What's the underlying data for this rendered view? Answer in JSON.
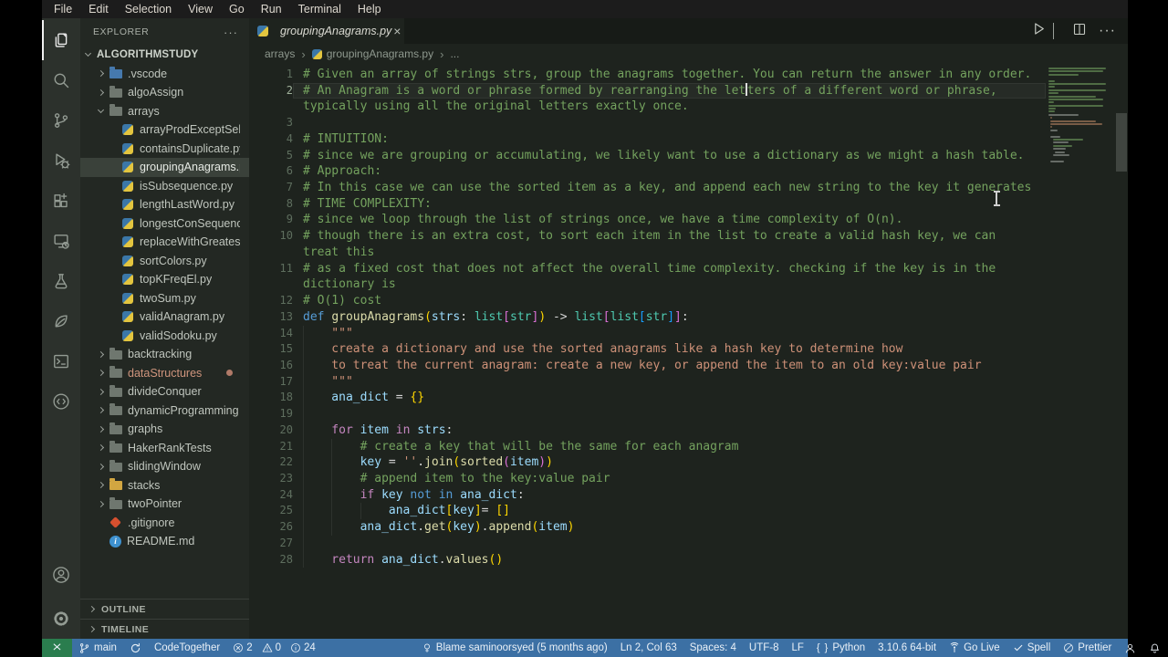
{
  "menu_bar": {
    "items": [
      "File",
      "Edit",
      "Selection",
      "View",
      "Go",
      "Run",
      "Terminal",
      "Help"
    ]
  },
  "activity_bar": {
    "top": [
      {
        "name": "explorer",
        "icon": "files-icon",
        "active": true
      },
      {
        "name": "search",
        "icon": "search-icon",
        "active": false
      },
      {
        "name": "source-control",
        "icon": "source-control-icon",
        "active": false
      },
      {
        "name": "run-debug",
        "icon": "debug-icon",
        "active": false
      },
      {
        "name": "extensions",
        "icon": "extensions-icon",
        "active": false
      },
      {
        "name": "remote-explorer",
        "icon": "remote-explorer-icon",
        "active": false
      },
      {
        "name": "testing",
        "icon": "beaker-icon",
        "active": false
      },
      {
        "name": "mongodb",
        "icon": "leaf-icon",
        "active": false
      },
      {
        "name": "terminal-tool",
        "icon": "terminal-box-icon",
        "active": false
      },
      {
        "name": "live-code",
        "icon": "code-circle-icon",
        "active": false
      }
    ],
    "bottom": [
      {
        "name": "accounts",
        "icon": "account-icon",
        "active": false
      },
      {
        "name": "settings",
        "icon": "gear-icon",
        "active": false
      }
    ]
  },
  "sidebar": {
    "title": "EXPLORER",
    "more_glyph": "···",
    "root": "ALGORITHMSTUDY",
    "tree": [
      {
        "label": ".vscode",
        "level": 1,
        "chevron": "right",
        "icon": "vscode-folder-icon"
      },
      {
        "label": "algoAssign",
        "level": 1,
        "chevron": "right",
        "icon": "folder-icon"
      },
      {
        "label": "arrays",
        "level": 1,
        "chevron": "down",
        "icon": "folder-icon"
      },
      {
        "label": "arrayProdExceptSel...",
        "level": 2,
        "icon": "python-icon"
      },
      {
        "label": "containsDuplicate.py",
        "level": 2,
        "icon": "python-icon"
      },
      {
        "label": "groupingAnagrams.py",
        "level": 2,
        "icon": "python-icon",
        "selected": true
      },
      {
        "label": "isSubsequence.py",
        "level": 2,
        "icon": "python-icon"
      },
      {
        "label": "lengthLastWord.py",
        "level": 2,
        "icon": "python-icon"
      },
      {
        "label": "longestConSequenc...",
        "level": 2,
        "icon": "python-icon"
      },
      {
        "label": "replaceWithGreates...",
        "level": 2,
        "icon": "python-icon"
      },
      {
        "label": "sortColors.py",
        "level": 2,
        "icon": "python-icon"
      },
      {
        "label": "topKFreqEl.py",
        "level": 2,
        "icon": "python-icon"
      },
      {
        "label": "twoSum.py",
        "level": 2,
        "icon": "python-icon"
      },
      {
        "label": "validAnagram.py",
        "level": 2,
        "icon": "python-icon"
      },
      {
        "label": "validSodoku.py",
        "level": 2,
        "icon": "python-icon"
      },
      {
        "label": "backtracking",
        "level": 1,
        "chevron": "right",
        "icon": "folder-icon"
      },
      {
        "label": "dataStructures",
        "level": 1,
        "chevron": "right",
        "icon": "folder-icon",
        "modified": true
      },
      {
        "label": "divideConquer",
        "level": 1,
        "chevron": "right",
        "icon": "folder-icon"
      },
      {
        "label": "dynamicProgramming",
        "level": 1,
        "chevron": "right",
        "icon": "folder-icon"
      },
      {
        "label": "graphs",
        "level": 1,
        "chevron": "right",
        "icon": "folder-icon"
      },
      {
        "label": "HakerRankTests",
        "level": 1,
        "chevron": "right",
        "icon": "folder-icon"
      },
      {
        "label": "slidingWindow",
        "level": 1,
        "chevron": "right",
        "icon": "folder-icon"
      },
      {
        "label": "stacks",
        "level": 1,
        "chevron": "right",
        "icon": "folder-yellow-icon"
      },
      {
        "label": "twoPointer",
        "level": 1,
        "chevron": "right",
        "icon": "folder-icon"
      },
      {
        "label": ".gitignore",
        "level": 1,
        "icon": "gitignore-icon"
      },
      {
        "label": "README.md",
        "level": 1,
        "icon": "info-icon"
      }
    ],
    "panels": [
      {
        "label": "OUTLINE"
      },
      {
        "label": "TIMELINE"
      }
    ]
  },
  "editor": {
    "tab": {
      "label": "groupingAnagrams.py",
      "icon": "python-icon",
      "close_glyph": "×"
    },
    "actions": [
      {
        "name": "run",
        "icon": "play-icon"
      },
      {
        "name": "run-dropdown",
        "icon": "chevron-down-icon"
      },
      {
        "name": "split-editor",
        "icon": "split-icon"
      },
      {
        "name": "more-actions",
        "icon": "ellipsis-icon"
      }
    ],
    "breadcrumb_separator": "›",
    "breadcrumbs": [
      {
        "label": "arrays"
      },
      {
        "label": "groupingAnagrams.py",
        "icon": "python-icon"
      },
      {
        "label": "..."
      }
    ],
    "code": [
      {
        "n": "1",
        "rows": [
          [
            [
              "cm",
              "# Given an array of strings strs, group the anagrams together. You can return the answer in any order."
            ]
          ]
        ]
      },
      {
        "n": "2",
        "current": true,
        "rows": [
          [
            [
              "cm",
              "# An Anagram is a word or phrase formed by rearranging the let"
            ],
            [
              "caret",
              ""
            ],
            [
              "cm",
              "ters of a different word or phrase,"
            ]
          ],
          [
            [
              "cm",
              "typically using all the original letters exactly once."
            ]
          ]
        ]
      },
      {
        "n": "3",
        "rows": [
          []
        ]
      },
      {
        "n": "4",
        "rows": [
          [
            [
              "cm",
              "# INTUITION:"
            ]
          ]
        ]
      },
      {
        "n": "5",
        "rows": [
          [
            [
              "cm",
              "# since we are grouping or accumulating, we likely want to use a dictionary as we might a hash table."
            ]
          ]
        ]
      },
      {
        "n": "6",
        "rows": [
          [
            [
              "cm",
              "# Approach:"
            ]
          ]
        ]
      },
      {
        "n": "7",
        "rows": [
          [
            [
              "cm",
              "# In this case we can use the sorted item as a key, and append each new string to the key it generates"
            ]
          ]
        ]
      },
      {
        "n": "8",
        "rows": [
          [
            [
              "cm",
              "# TIME COMPLEXITY:"
            ]
          ]
        ]
      },
      {
        "n": "9",
        "rows": [
          [
            [
              "cm",
              "# since we loop through the list of strings once, we have a time complexity of O(n)."
            ]
          ]
        ]
      },
      {
        "n": "10",
        "rows": [
          [
            [
              "cm",
              "# though there is an extra cost, to sort each item in the list to create a valid hash key, we can"
            ]
          ],
          [
            [
              "cm",
              "treat this"
            ]
          ]
        ]
      },
      {
        "n": "11",
        "rows": [
          [
            [
              "cm",
              "# as a fixed cost that does not affect the overall time complexity. checking if the key is in the"
            ]
          ],
          [
            [
              "cm",
              "dictionary is"
            ]
          ]
        ]
      },
      {
        "n": "12",
        "rows": [
          [
            [
              "cm",
              "# O(1) cost"
            ]
          ]
        ]
      },
      {
        "n": "13",
        "rows": [
          [
            [
              "kw",
              "def "
            ],
            [
              "fn",
              "groupAnagrams"
            ],
            [
              "b1",
              "("
            ],
            [
              "vr",
              "strs"
            ],
            [
              "pu",
              ": "
            ],
            [
              "ty",
              "list"
            ],
            [
              "b2",
              "["
            ],
            [
              "ty",
              "str"
            ],
            [
              "b2",
              "]"
            ],
            [
              "b1",
              ")"
            ],
            [
              "pu",
              " -> "
            ],
            [
              "ty",
              "list"
            ],
            [
              "b2",
              "["
            ],
            [
              "ty",
              "list"
            ],
            [
              "b3",
              "["
            ],
            [
              "ty",
              "str"
            ],
            [
              "b3",
              "]"
            ],
            [
              "b2",
              "]"
            ],
            [
              "pu",
              ":"
            ]
          ]
        ]
      },
      {
        "n": "14",
        "rows": [
          [
            [
              "ind",
              "    "
            ],
            [
              "st",
              "\"\"\""
            ]
          ]
        ]
      },
      {
        "n": "15",
        "rows": [
          [
            [
              "ind",
              "    "
            ],
            [
              "st",
              "create a dictionary and use the sorted anagrams like a hash key to determine how"
            ]
          ]
        ]
      },
      {
        "n": "16",
        "rows": [
          [
            [
              "ind",
              "    "
            ],
            [
              "st",
              "to treat the current anagram: create a new key, or append the item to an old key:value pair"
            ]
          ]
        ]
      },
      {
        "n": "17",
        "rows": [
          [
            [
              "ind",
              "    "
            ],
            [
              "st",
              "\"\"\""
            ]
          ]
        ]
      },
      {
        "n": "18",
        "rows": [
          [
            [
              "ind",
              "    "
            ],
            [
              "vr",
              "ana_dict"
            ],
            [
              "pu",
              " = "
            ],
            [
              "b1",
              "{}"
            ]
          ]
        ]
      },
      {
        "n": "19",
        "rows": [
          [
            [
              "ind",
              "    "
            ]
          ]
        ]
      },
      {
        "n": "20",
        "rows": [
          [
            [
              "ind",
              "    "
            ],
            [
              "ctl",
              "for"
            ],
            [
              "pu",
              " "
            ],
            [
              "vr",
              "item"
            ],
            [
              "pu",
              " "
            ],
            [
              "ctl",
              "in"
            ],
            [
              "pu",
              " "
            ],
            [
              "vr",
              "strs"
            ],
            [
              "pu",
              ":"
            ]
          ]
        ]
      },
      {
        "n": "21",
        "rows": [
          [
            [
              "ind",
              "    "
            ],
            [
              "ind",
              "    "
            ],
            [
              "cm",
              "# create a key that will be the same for each anagram"
            ]
          ]
        ]
      },
      {
        "n": "22",
        "rows": [
          [
            [
              "ind",
              "    "
            ],
            [
              "ind",
              "    "
            ],
            [
              "vr",
              "key"
            ],
            [
              "pu",
              " = "
            ],
            [
              "st",
              "''"
            ],
            [
              "pu",
              "."
            ],
            [
              "fn",
              "join"
            ],
            [
              "b1",
              "("
            ],
            [
              "fn",
              "sorted"
            ],
            [
              "b2",
              "("
            ],
            [
              "vr",
              "item"
            ],
            [
              "b2",
              ")"
            ],
            [
              "b1",
              ")"
            ]
          ]
        ]
      },
      {
        "n": "23",
        "rows": [
          [
            [
              "ind",
              "    "
            ],
            [
              "ind",
              "    "
            ],
            [
              "cm",
              "# append item to the key:value pair"
            ]
          ]
        ]
      },
      {
        "n": "24",
        "rows": [
          [
            [
              "ind",
              "    "
            ],
            [
              "ind",
              "    "
            ],
            [
              "ctl",
              "if"
            ],
            [
              "pu",
              " "
            ],
            [
              "vr",
              "key"
            ],
            [
              "pu",
              " "
            ],
            [
              "kw",
              "not"
            ],
            [
              "pu",
              " "
            ],
            [
              "kw",
              "in"
            ],
            [
              "pu",
              " "
            ],
            [
              "vr",
              "ana_dict"
            ],
            [
              "pu",
              ":"
            ]
          ]
        ]
      },
      {
        "n": "25",
        "rows": [
          [
            [
              "ind",
              "    "
            ],
            [
              "ind",
              "    "
            ],
            [
              "ind",
              "    "
            ],
            [
              "vr",
              "ana_dict"
            ],
            [
              "b1",
              "["
            ],
            [
              "vr",
              "key"
            ],
            [
              "b1",
              "]"
            ],
            [
              "pu",
              "= "
            ],
            [
              "b1",
              "[]"
            ]
          ]
        ]
      },
      {
        "n": "26",
        "rows": [
          [
            [
              "ind",
              "    "
            ],
            [
              "ind",
              "    "
            ],
            [
              "vr",
              "ana_dict"
            ],
            [
              "pu",
              "."
            ],
            [
              "fn",
              "get"
            ],
            [
              "b1",
              "("
            ],
            [
              "vr",
              "key"
            ],
            [
              "b1",
              ")"
            ],
            [
              "pu",
              "."
            ],
            [
              "fn",
              "append"
            ],
            [
              "b1",
              "("
            ],
            [
              "vr",
              "item"
            ],
            [
              "b1",
              ")"
            ]
          ]
        ]
      },
      {
        "n": "27",
        "rows": [
          [
            [
              "ind",
              "    "
            ]
          ]
        ]
      },
      {
        "n": "28",
        "rows": [
          [
            [
              "ind",
              "    "
            ],
            [
              "ctl",
              "return"
            ],
            [
              "pu",
              " "
            ],
            [
              "vr",
              "ana_dict"
            ],
            [
              "pu",
              "."
            ],
            [
              "fn",
              "values"
            ],
            [
              "b1",
              "()"
            ]
          ]
        ]
      }
    ]
  },
  "status_bar": {
    "colors": {
      "bar": "#3c70a4",
      "remote": "#2a7d4e"
    },
    "left": [
      {
        "name": "remote-indicator",
        "icon": "remote-icon",
        "text": "",
        "remote": true
      },
      {
        "name": "git-branch",
        "icon": "branch-icon",
        "text": "main"
      },
      {
        "name": "sync",
        "icon": "sync-icon",
        "text": ""
      },
      {
        "name": "codetogether",
        "text": "CodeTogether"
      },
      {
        "name": "problems",
        "groups": [
          {
            "icon": "error-icon",
            "n": "2"
          },
          {
            "icon": "warning-icon",
            "n": "0"
          },
          {
            "icon": "info-icon-status",
            "n": "24"
          }
        ]
      },
      {
        "name": "gitlens-blame",
        "icon": "blame-icon",
        "text": "Blame saminoorsyed (5 months ago)",
        "gap": true
      }
    ],
    "right": [
      {
        "name": "cursor-position",
        "text": "Ln 2, Col 63"
      },
      {
        "name": "indentation",
        "text": "Spaces: 4"
      },
      {
        "name": "encoding",
        "text": "UTF-8"
      },
      {
        "name": "eol",
        "text": "LF"
      },
      {
        "name": "language-mode",
        "icon": "braces-icon",
        "text": "Python"
      },
      {
        "name": "python-version",
        "text": "3.10.6 64-bit"
      },
      {
        "name": "go-live",
        "icon": "broadcast-icon",
        "text": "Go Live"
      },
      {
        "name": "spell",
        "icon": "check-icon",
        "text": "Spell"
      },
      {
        "name": "prettier",
        "icon": "slash-circle-icon",
        "text": "Prettier"
      },
      {
        "name": "feedback",
        "icon": "feedback-icon",
        "text": ""
      },
      {
        "name": "notifications",
        "icon": "bell-icon",
        "text": ""
      }
    ]
  }
}
